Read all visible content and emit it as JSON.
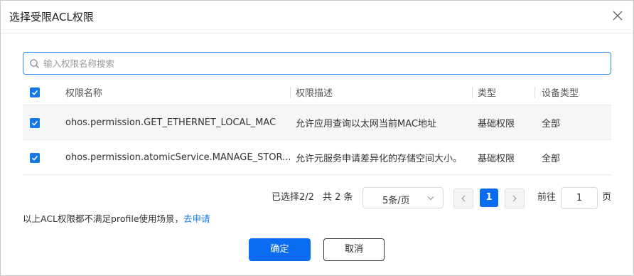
{
  "dialog": {
    "title": "选择受限ACL权限"
  },
  "search": {
    "placeholder": "输入权限名称搜索",
    "value": ""
  },
  "table": {
    "columns": [
      "权限名称",
      "权限描述",
      "类型",
      "设备类型"
    ],
    "rows": [
      {
        "name": "ohos.permission.GET_ETHERNET_LOCAL_MAC",
        "desc": "允许应用查询以太网当前MAC地址",
        "type": "基础权限",
        "device": "全部",
        "checked": true
      },
      {
        "name": "ohos.permission.atomicService.MANAGE_STOR...",
        "desc": "允许元服务申请差异化的存储空间大小。",
        "type": "基础权限",
        "device": "全部",
        "checked": true
      }
    ]
  },
  "pagination": {
    "selected": "已选择2/2",
    "total": "共 2 条",
    "page_size": "5条/页",
    "current_page": "1",
    "goto_label": "前往",
    "goto_value": "1",
    "page_unit": "页"
  },
  "note": {
    "text": "以上ACL权限都不满足profile使用场景，",
    "link": "去申请"
  },
  "buttons": {
    "ok": "确定",
    "cancel": "取消"
  },
  "colors": {
    "accent": "#0a6cf0",
    "checkbox": "#1677e8",
    "row_highlight": "#f5f6f8"
  },
  "icons": {
    "close": "close-icon",
    "search": "search-icon",
    "chevron": "chevron-down-icon",
    "prev": "chevron-left-icon",
    "next": "chevron-right-icon",
    "check": "check-icon"
  }
}
